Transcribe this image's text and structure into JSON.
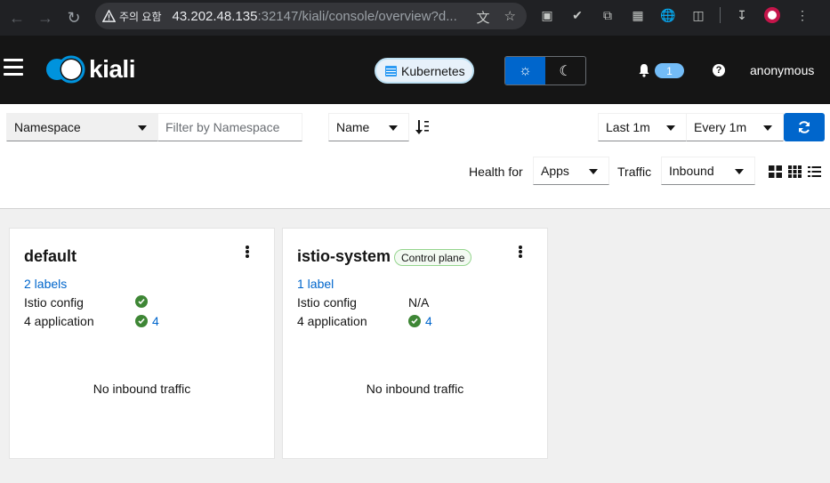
{
  "browser": {
    "security_warning": "주의 요함",
    "url_host": "43.202.48.135",
    "url_rest": ":32147/kiali/console/overview?d..."
  },
  "masthead": {
    "logo_text": "kiali",
    "cluster_label": "Kubernetes",
    "notification_count": "1",
    "help_glyph": "?",
    "user": "anonymous"
  },
  "toolbar": {
    "filter_type": "Namespace",
    "filter_placeholder": "Filter by Namespace",
    "sort_field": "Name",
    "time_range": "Last 1m",
    "refresh_interval": "Every 1m",
    "health_for_label": "Health for",
    "health_for_value": "Apps",
    "traffic_label": "Traffic",
    "traffic_value": "Inbound"
  },
  "namespaces": [
    {
      "name": "default",
      "badge": "",
      "labels_link": "2 labels",
      "istio_config_label": "Istio config",
      "istio_config_status": "ok",
      "istio_config_text": "",
      "apps_label": "4 application",
      "apps_count": "4",
      "traffic_message": "No inbound traffic"
    },
    {
      "name": "istio-system",
      "badge": "Control plane",
      "labels_link": "1 label",
      "istio_config_label": "Istio config",
      "istio_config_status": "na",
      "istio_config_text": "N/A",
      "apps_label": "4 application",
      "apps_count": "4",
      "traffic_message": "No inbound traffic"
    }
  ],
  "colors": {
    "masthead_bg": "#151515",
    "primary_blue": "#0066cc",
    "success_green": "#3e8635",
    "badge_blue": "#73bcf7"
  }
}
